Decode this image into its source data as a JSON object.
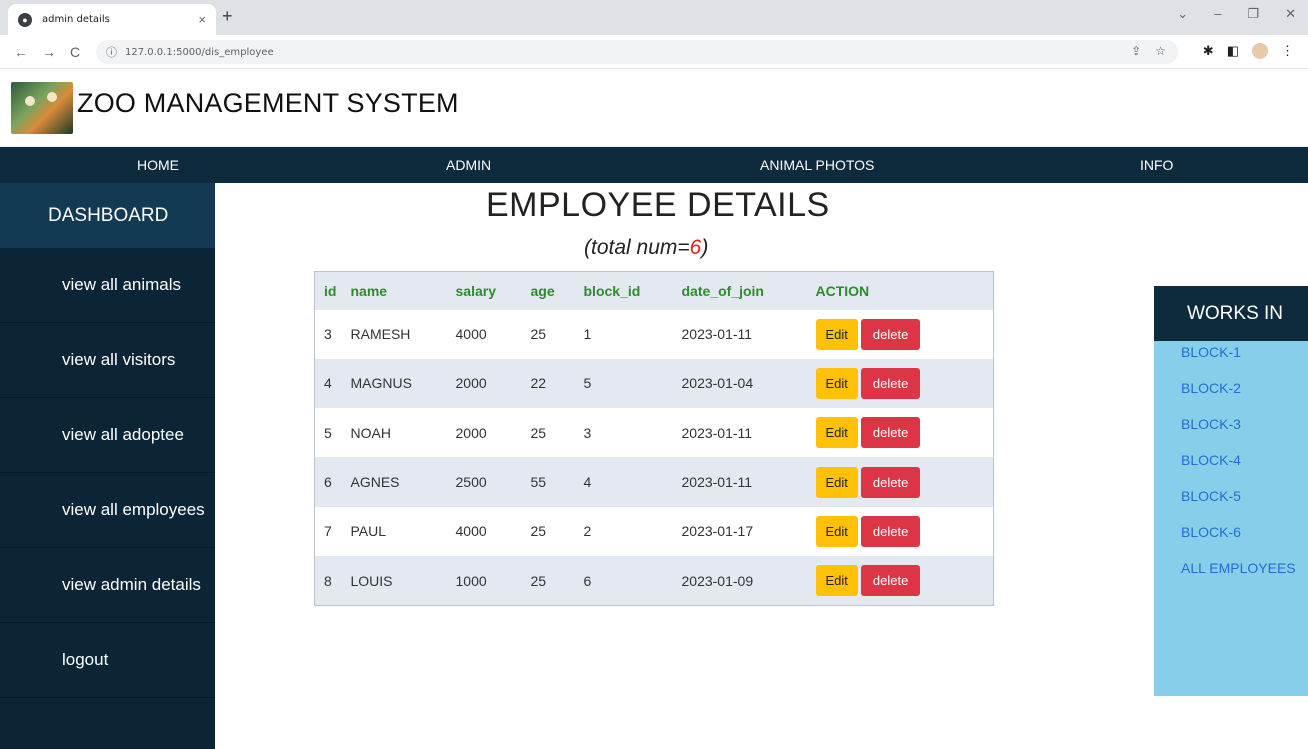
{
  "browser": {
    "tab_title": "admin details",
    "tab_close": "×",
    "new_tab": "+",
    "url": "127.0.0.1:5000/dis_employee",
    "back": "←",
    "forward": "→",
    "reload": "C",
    "info_icon": "ⓘ",
    "window_minimize": "–",
    "window_restore": "❐",
    "window_close": "✕",
    "dropdown": "⌄"
  },
  "site": {
    "title": "ZOO MANAGEMENT SYSTEM"
  },
  "topnav": {
    "items": [
      "HOME",
      "ADMIN",
      "ANIMAL PHOTOS",
      "INFO"
    ]
  },
  "sidebar": {
    "header": "DASHBOARD",
    "items": [
      "view all animals",
      "view all visitors",
      "view all adoptee",
      "view all employees",
      "view admin details",
      "logout"
    ]
  },
  "main": {
    "title": "EMPLOYEE DETAILS",
    "total_prefix": "(total num=",
    "total_value": "6",
    "total_suffix": ")",
    "columns": [
      "id",
      "name",
      "salary",
      "age",
      "block_id",
      "date_of_join",
      "ACTION"
    ],
    "edit_label": "Edit",
    "delete_label": "delete",
    "rows": [
      {
        "id": "3",
        "name": "RAMESH",
        "salary": "4000",
        "age": "25",
        "block_id": "1",
        "date_of_join": "2023-01-11"
      },
      {
        "id": "4",
        "name": "MAGNUS",
        "salary": "2000",
        "age": "22",
        "block_id": "5",
        "date_of_join": "2023-01-04"
      },
      {
        "id": "5",
        "name": "NOAH",
        "salary": "2000",
        "age": "25",
        "block_id": "3",
        "date_of_join": "2023-01-11"
      },
      {
        "id": "6",
        "name": "AGNES",
        "salary": "2500",
        "age": "55",
        "block_id": "4",
        "date_of_join": "2023-01-11"
      },
      {
        "id": "7",
        "name": "PAUL",
        "salary": "4000",
        "age": "25",
        "block_id": "2",
        "date_of_join": "2023-01-17"
      },
      {
        "id": "8",
        "name": "LOUIS",
        "salary": "1000",
        "age": "25",
        "block_id": "6",
        "date_of_join": "2023-01-09"
      }
    ]
  },
  "works_in": {
    "header": "WORKS IN",
    "links": [
      "BLOCK-1",
      "BLOCK-2",
      "BLOCK-3",
      "BLOCK-4",
      "BLOCK-5",
      "BLOCK-6",
      "ALL EMPLOYEES"
    ]
  },
  "colors": {
    "nav_bg": "#0e2a3d",
    "sidebar_bg": "#0b2536",
    "header_green": "#2e8b2e",
    "edit_yellow": "#ffc107",
    "delete_red": "#dc3545",
    "panel_blue": "#87ceeb",
    "link_blue": "#1f6fd6",
    "total_red": "#e02020"
  }
}
